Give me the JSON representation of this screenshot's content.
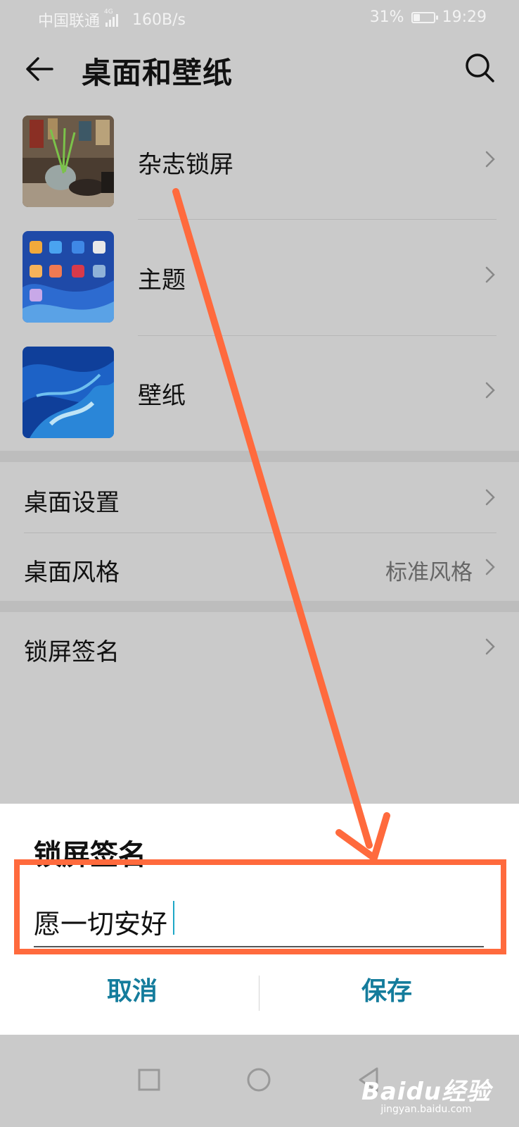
{
  "status_bar": {
    "carrier": "中国联通",
    "network": "4G",
    "speed": "160B/s",
    "battery_percent": "31%",
    "battery_level": 0.31,
    "time": "19:29"
  },
  "header": {
    "title": "桌面和壁纸",
    "back_icon": "back-arrow-icon",
    "search_icon": "search-icon"
  },
  "list": {
    "section1": [
      {
        "label": "杂志锁屏",
        "thumb": "magazine-lockscreen-thumbnail"
      },
      {
        "label": "主题",
        "thumb": "theme-thumbnail"
      },
      {
        "label": "壁纸",
        "thumb": "wallpaper-thumbnail"
      }
    ],
    "section2": [
      {
        "label": "桌面设置",
        "value": ""
      },
      {
        "label": "桌面风格",
        "value": "标准风格"
      }
    ],
    "section3": [
      {
        "label": "锁屏签名"
      }
    ]
  },
  "dialog": {
    "title": "锁屏签名",
    "input_value": "愿一切安好",
    "cancel_label": "取消",
    "save_label": "保存"
  },
  "annotation": {
    "color": "#ff6a3d"
  },
  "nav": {
    "recent_icon": "square-icon",
    "home_icon": "circle-icon",
    "back_icon": "triangle-back-icon"
  },
  "watermark": {
    "logo": "Baidu经验",
    "url": "jingyan.baidu.com"
  }
}
